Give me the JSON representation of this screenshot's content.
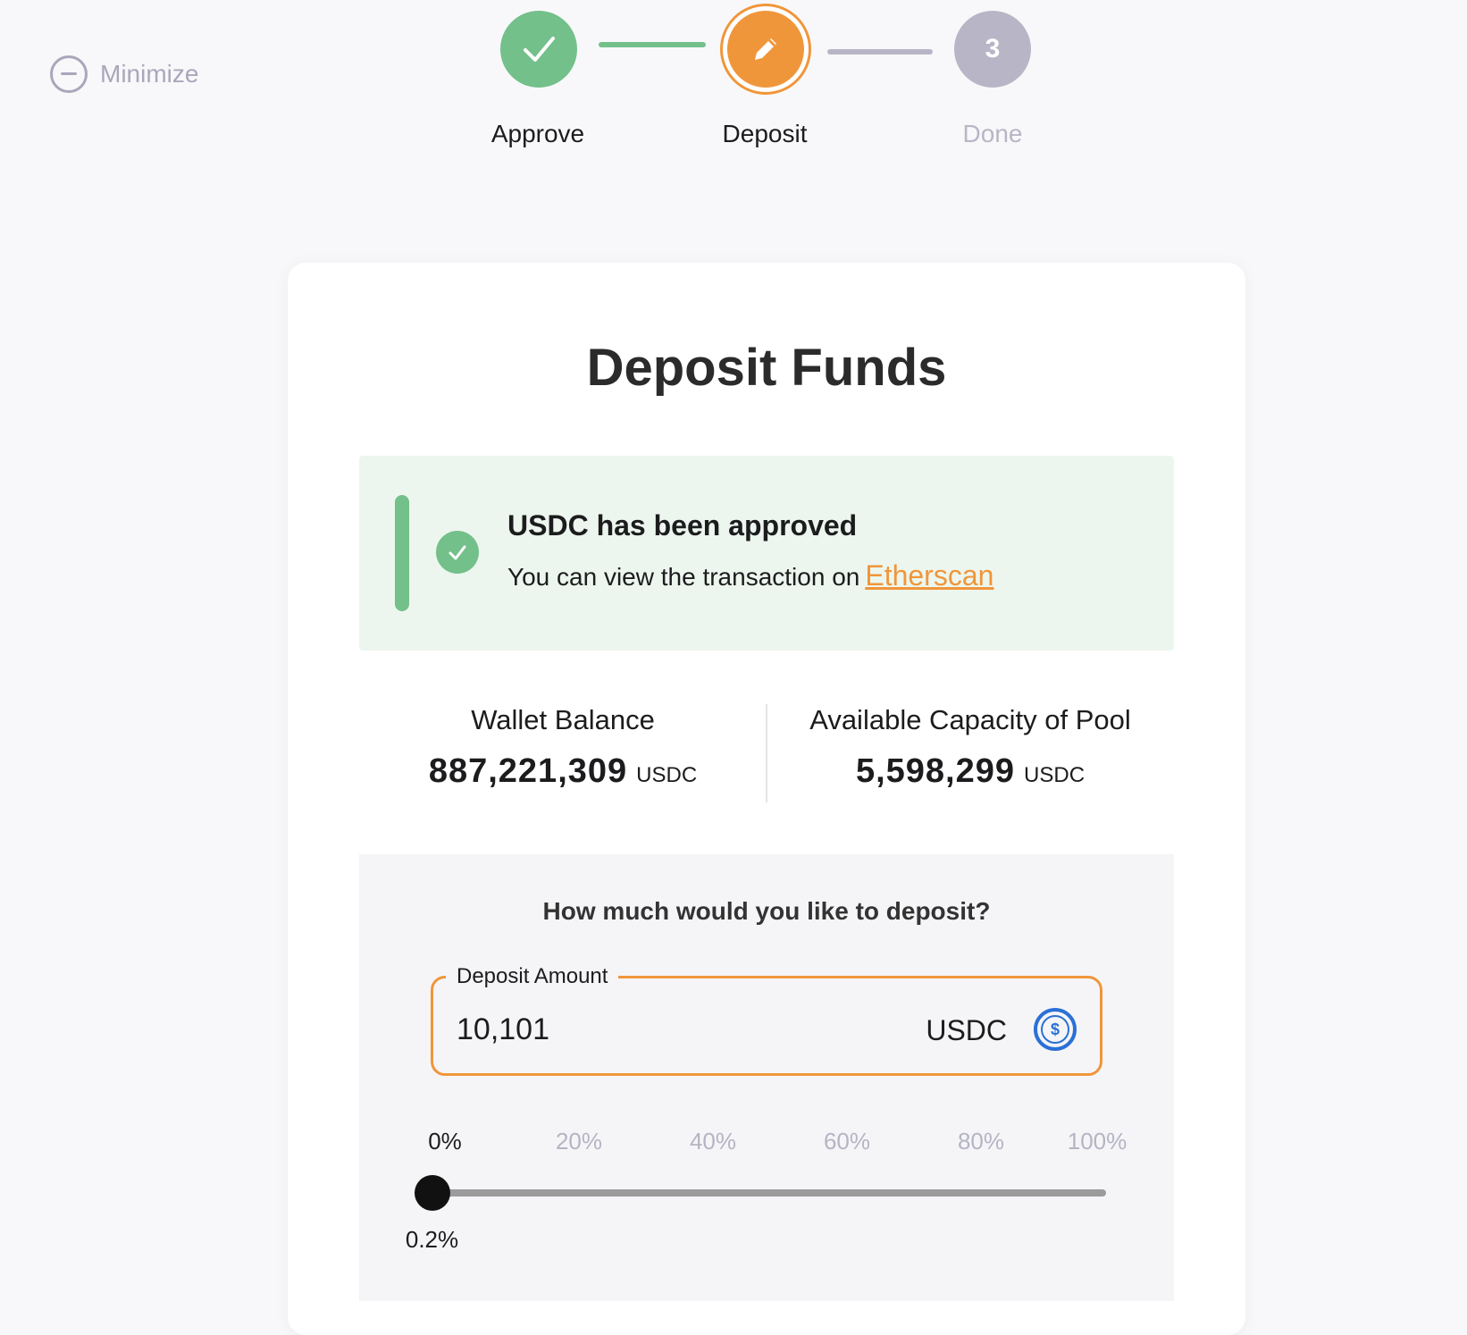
{
  "minimize_label": "Minimize",
  "stepper": {
    "steps": [
      {
        "label": "Approve",
        "state": "complete"
      },
      {
        "label": "Deposit",
        "state": "active"
      },
      {
        "label": "Done",
        "number": "3",
        "state": "pending"
      }
    ]
  },
  "card": {
    "title": "Deposit Funds",
    "alert": {
      "title": "USDC has been approved",
      "text": "You can view the transaction on",
      "link": "Etherscan"
    },
    "wallet": {
      "label": "Wallet Balance",
      "value": "887,221,309",
      "unit": "USDC"
    },
    "capacity": {
      "label": "Available Capacity of Pool",
      "value": "5,598,299",
      "unit": "USDC"
    },
    "deposit": {
      "question": "How much would you like to deposit?",
      "field_label": "Deposit Amount",
      "amount": "10,101",
      "unit": "USDC",
      "icon": "usdc-coin-icon",
      "ticks": [
        "0%",
        "20%",
        "40%",
        "60%",
        "80%",
        "100%"
      ],
      "slider_value_label": "0.2%",
      "slider_fraction": 0.002
    }
  },
  "colors": {
    "success": "#73c08a",
    "accent": "#f0963a",
    "pending": "#b8b6c6",
    "usdc": "#2a70d6"
  }
}
